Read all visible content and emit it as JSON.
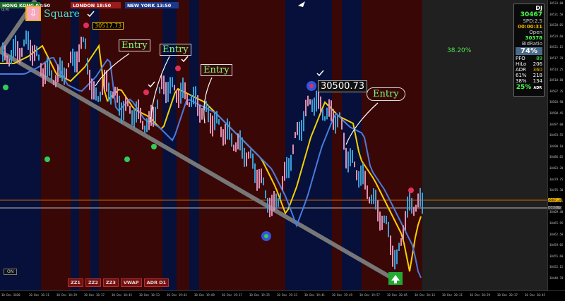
{
  "sessions": [
    {
      "name": "HONG KONG",
      "time": "02:50",
      "color": "#1b6b2a"
    },
    {
      "name": "LONDON",
      "time": "18:50",
      "color": "#9a1c1c"
    },
    {
      "name": "NEW YORK",
      "time": "13:50",
      "color": "#1d3a8a"
    }
  ],
  "symbol_label": "DJ,M1",
  "square_label": "Square",
  "entries": [
    "Entry",
    "Entry",
    "Entry",
    "Entry"
  ],
  "price_tags": {
    "left": "30517.73",
    "right": "30500.73"
  },
  "fib_level": "38.20%",
  "panel": {
    "symbol": "DJ",
    "price": "30467",
    "spread": "SPD:2.5",
    "countdown": "00:00:31",
    "open_label": "Open",
    "open_value": "30378",
    "bidratio_label": "BidRatio",
    "bidratio_value": "74%",
    "stats": [
      {
        "k": "PFO",
        "v": "89"
      },
      {
        "k": "HiLo",
        "v": "206"
      },
      {
        "k": "ADR",
        "v": "360"
      },
      {
        "k": "61%",
        "v": "218"
      },
      {
        "k": "38%",
        "v": "134"
      }
    ],
    "adr_pct": "25%",
    "adr_pct_label": "ADR"
  },
  "buttons": [
    "ZZ1",
    "ZZ2",
    "ZZ3",
    "VWAP",
    "ADR D1"
  ],
  "on_button": "ON",
  "y_ticks": [
    "30533.00",
    "30531.50",
    "30528.05",
    "30524.60",
    "30521.15",
    "30517.70",
    "30514.25",
    "30510.80",
    "30507.35",
    "30503.90",
    "30500.45",
    "30497.00",
    "30493.55",
    "30490.10",
    "30486.65",
    "30483.20",
    "30479.75",
    "30476.30",
    "30472.85",
    "30469.40",
    "30465.95",
    "30462.50",
    "30459.05",
    "30455.60",
    "30452.15",
    "30448.70"
  ],
  "current_price_tags": [
    "30467.25",
    "30465.75"
  ],
  "x_ticks": [
    "30 Dec 2020",
    "30 Dec 18:21",
    "30 Dec 18:29",
    "30 Dec 18:37",
    "30 Dec 18:45",
    "30 Dec 18:53",
    "30 Dec 19:01",
    "30 Dec 19:09",
    "30 Dec 19:17",
    "30 Dec 19:25",
    "30 Dec 19:33",
    "30 Dec 19:41",
    "30 Dec 19:49",
    "30 Dec 19:57",
    "30 Dec 20:05",
    "30 Dec 20:13",
    "30 Dec 20:21",
    "30 Dec 20:29",
    "30 Dec 20:37",
    "30 Dec 20:45"
  ]
}
